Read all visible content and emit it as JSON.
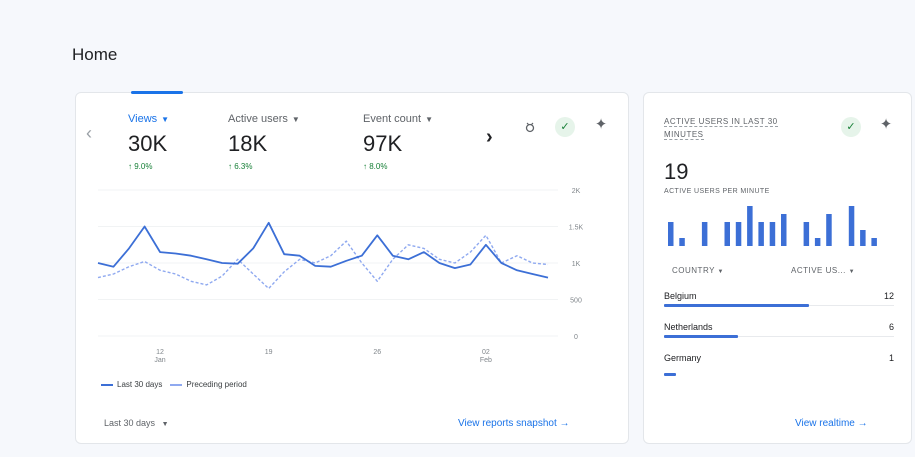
{
  "page": {
    "title": "Home"
  },
  "colors": {
    "accent": "#1a73e8",
    "line_current": "#3c6fd6",
    "line_previous": "#8fa9f0",
    "positive": "#188038"
  },
  "main_card": {
    "metrics": [
      {
        "label": "Views",
        "value": "30K",
        "change": "↑ 9.0%"
      },
      {
        "label": "Active users",
        "value": "18K",
        "change": "↑ 6.3%"
      },
      {
        "label": "Event count",
        "value": "97K",
        "change": "↑ 8.0%"
      }
    ],
    "icons": [
      "chevron-left-icon",
      "chevron-right-icon",
      "insights-icon",
      "check-circle-icon",
      "sparkle-icon"
    ],
    "legend": {
      "current": "Last 30 days",
      "previous": "Preceding period"
    },
    "date_range": "Last 30 days",
    "link": "View reports snapshot"
  },
  "chart_data": {
    "type": "line",
    "y_ticks": [
      "2K",
      "1.5K",
      "1K",
      "500",
      "0"
    ],
    "ylim": [
      0,
      2000
    ],
    "x_ticks": [
      {
        "day": "12",
        "month": "Jan",
        "index": 4
      },
      {
        "day": "19",
        "month": "",
        "index": 11
      },
      {
        "day": "26",
        "month": "",
        "index": 18
      },
      {
        "day": "02",
        "month": "Feb",
        "index": 25
      }
    ],
    "grid": true,
    "legend_placement": "bottom-left",
    "series": [
      {
        "name": "Last 30 days",
        "style": "solid",
        "values": [
          1000,
          950,
          1200,
          1500,
          1150,
          1130,
          1100,
          1050,
          1000,
          990,
          1200,
          1550,
          1120,
          1100,
          960,
          950,
          1030,
          1100,
          1380,
          1100,
          1050,
          1150,
          1000,
          930,
          980,
          1250,
          1000,
          900,
          850,
          800
        ]
      },
      {
        "name": "Preceding period",
        "style": "dashed",
        "values": [
          800,
          850,
          950,
          1020,
          900,
          850,
          750,
          700,
          820,
          1050,
          850,
          650,
          880,
          1050,
          1000,
          1100,
          1300,
          1000,
          750,
          1050,
          1250,
          1200,
          1050,
          1000,
          1150,
          1380,
          1000,
          1100,
          1000,
          980
        ]
      }
    ]
  },
  "realtime_card": {
    "title": "ACTIVE USERS IN LAST 30 MINUTES",
    "value": "19",
    "subtitle": "ACTIVE USERS PER MINUTE",
    "bars": [
      3,
      1,
      0,
      3,
      0,
      3,
      3,
      5,
      3,
      3,
      4,
      0,
      3,
      1,
      4,
      0,
      5,
      2,
      1
    ],
    "columns": {
      "country": "COUNTRY",
      "users": "ACTIVE US..."
    },
    "rows": [
      {
        "country": "Belgium",
        "users": "12",
        "share": 0.63
      },
      {
        "country": "Netherlands",
        "users": "6",
        "share": 0.32
      },
      {
        "country": "Germany",
        "users": "1",
        "share": 0.05
      }
    ],
    "link": "View realtime"
  }
}
